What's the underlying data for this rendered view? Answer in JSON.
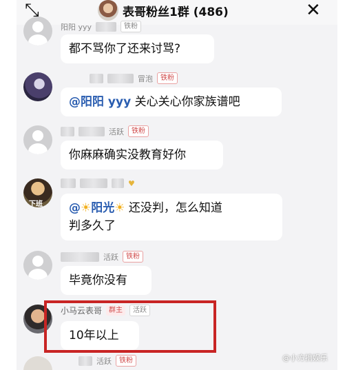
{
  "header": {
    "title": "表哥粉丝1群 (486)",
    "expand_icon": "⤡",
    "close_icon": "✕"
  },
  "messages": [
    {
      "user": "阳阳 yyy",
      "badge": "铁粉",
      "text": "都不骂你了还来讨骂?"
    },
    {
      "status": "冒泡",
      "badge": "铁粉",
      "mention": "@阳阳 yyy",
      "text": " 关心关心你家族谱吧"
    },
    {
      "status": "活跃",
      "badge": "铁粉",
      "text": "你麻麻确实没教育好你"
    },
    {
      "avatar_label": "下班",
      "mention_prefix": "@",
      "sun": "☀",
      "mention_name": "阳光",
      "text_line1": " 还没判，怎么知道",
      "text_line2": "判多久了"
    },
    {
      "status": "活跃",
      "badge": "铁粉",
      "text": "毕竟你没有"
    },
    {
      "user": "小马云表哥",
      "role_badge": "群主",
      "status": "活跃",
      "text": "10年以上"
    },
    {
      "status": "活跃",
      "badge": "铁粉"
    }
  ],
  "watermark": "@小方摘娱乐"
}
